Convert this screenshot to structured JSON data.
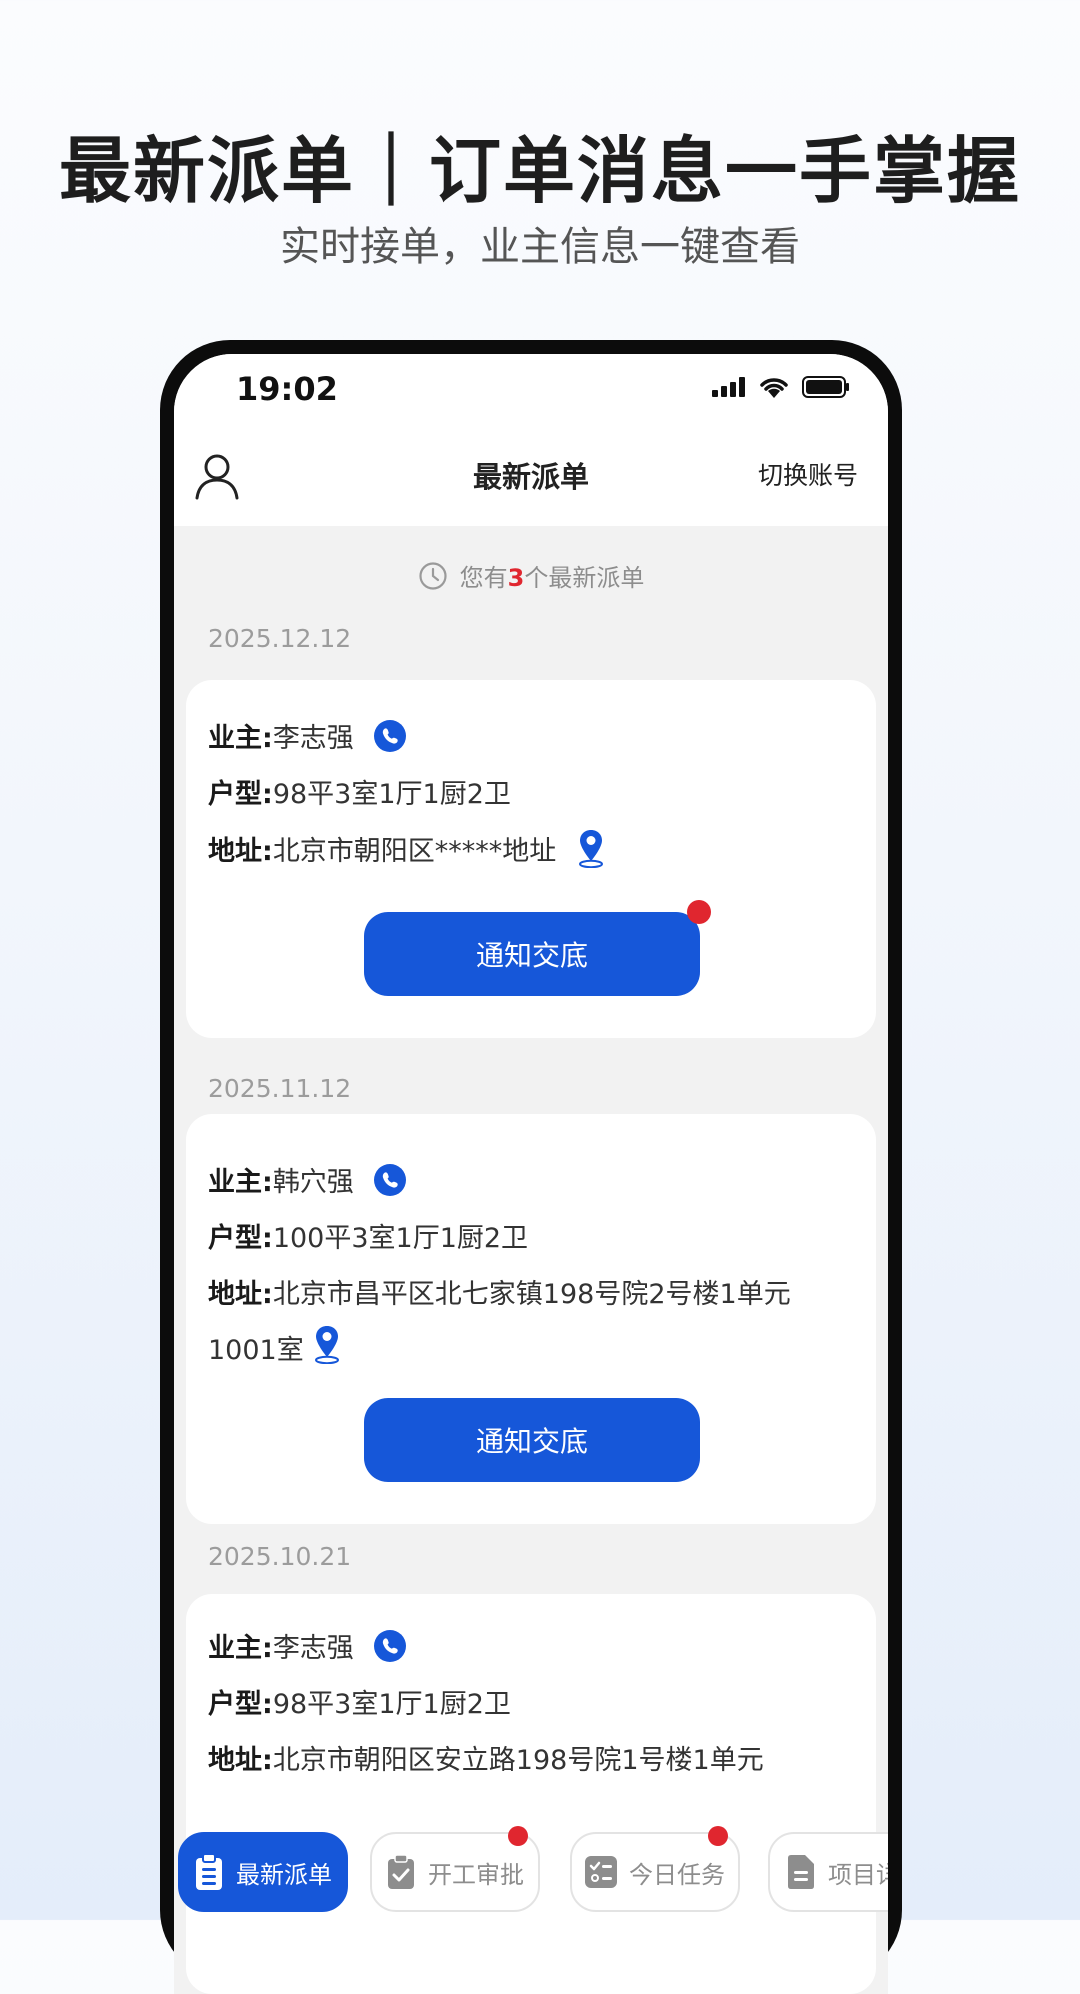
{
  "promo": {
    "title": "最新派单｜订单消息一手掌握",
    "subtitle": "实时接单，业主信息一键查看"
  },
  "status_bar": {
    "time": "19:02"
  },
  "navbar": {
    "title": "最新派单",
    "switch_account": "切换账号"
  },
  "notice": {
    "prefix": "您有",
    "count": "3",
    "suffix": "个最新派单"
  },
  "orders": [
    {
      "date": "2025.12.12",
      "owner_label": "业主:",
      "owner": "李志强",
      "layout_label": "户型:",
      "layout": "98平3室1厅1厨2卫",
      "address_label": "地址:",
      "address": "北京市朝阳区*****地址",
      "address_cont": "",
      "button": "通知交底",
      "has_badge": true
    },
    {
      "date": "2025.11.12",
      "owner_label": "业主:",
      "owner": "韩穴强",
      "layout_label": "户型:",
      "layout": "100平3室1厅1厨2卫",
      "address_label": "地址:",
      "address": "北京市昌平区北七家镇198号院2号楼1单元",
      "address_cont": "1001室",
      "button": "通知交底",
      "has_badge": false
    },
    {
      "date": "2025.10.21",
      "owner_label": "业主:",
      "owner": "李志强",
      "layout_label": "户型:",
      "layout": "98平3室1厅1厨2卫",
      "address_label": "地址:",
      "address": "北京市朝阳区安立路198号院1号楼1单元",
      "address_cont": "",
      "button": "",
      "has_badge": false
    }
  ],
  "tabs": [
    {
      "label": "最新派单",
      "icon": "clipboard-list-icon",
      "active": true,
      "badge": false
    },
    {
      "label": "开工审批",
      "icon": "clipboard-check-icon",
      "active": false,
      "badge": true
    },
    {
      "label": "今日任务",
      "icon": "checklist-icon",
      "active": false,
      "badge": true
    },
    {
      "label": "项目详情",
      "icon": "document-icon",
      "active": false,
      "badge": false
    }
  ],
  "colors": {
    "accent": "#1657d9",
    "badge": "#e0262f",
    "screen_bg": "#f2f2f2"
  }
}
